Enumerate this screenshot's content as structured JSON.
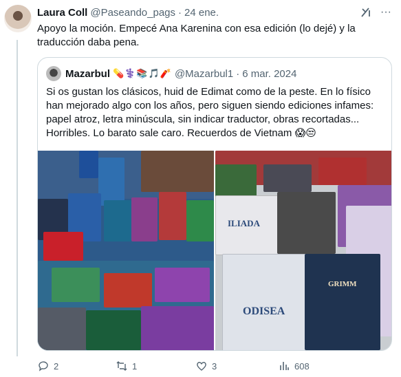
{
  "tweet": {
    "author_name": "Laura Coll",
    "handle": "@Paseando_pags",
    "separator": "·",
    "date": "24 ene.",
    "text": "Apoyo la moción. Empecé Ana Karenina con esa edición (lo dejé) y la traducción daba pena."
  },
  "quote": {
    "author_name": "Mazarbul",
    "name_emojis": "💊⚕️📚🎵🧨",
    "handle": "@Mazarbul1",
    "separator": "·",
    "date": "6 mar. 2024",
    "text": "Si os gustan los clásicos, huid de Edimat como de la peste. En lo físico han mejorado algo con los años, pero siguen siendo ediciones infames: papel atroz, letra minúscula, sin indicar traductor, obras recortadas... Horribles. Lo barato sale caro. Recuerdos de Vietnam 😱😒"
  },
  "photo_right_titles": {
    "iliada": "ILIADA",
    "odisea": "ODISEA",
    "grimm": "GRIMM"
  },
  "actions": {
    "replies": "2",
    "retweets": "1",
    "likes": "3",
    "views": "608"
  },
  "colors": {
    "text": "#0f1419",
    "secondary": "#536471",
    "border": "#cfd9de"
  }
}
